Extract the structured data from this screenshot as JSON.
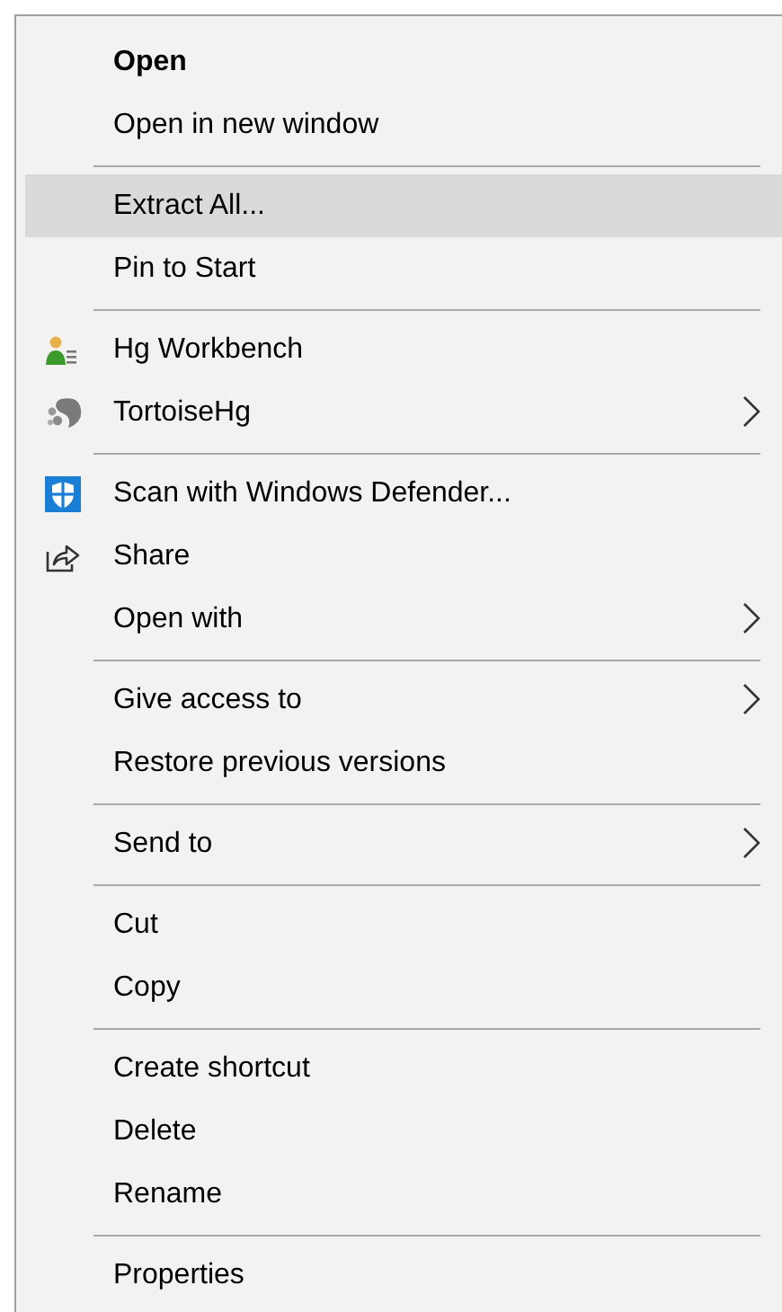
{
  "context_menu": {
    "groups": [
      [
        {
          "label": "Open",
          "kind": "plain",
          "default": true,
          "selected": false,
          "submenu": false
        },
        {
          "label": "Open in new window",
          "kind": "plain",
          "default": false,
          "selected": false,
          "submenu": false
        }
      ],
      [
        {
          "label": "Extract All...",
          "kind": "plain",
          "default": false,
          "selected": true,
          "submenu": false
        },
        {
          "label": "Pin to Start",
          "kind": "plain",
          "default": false,
          "selected": false,
          "submenu": false
        }
      ],
      [
        {
          "label": "Hg Workbench",
          "kind": "workbench",
          "default": false,
          "selected": false,
          "submenu": false
        },
        {
          "label": "TortoiseHg",
          "kind": "tortoise",
          "default": false,
          "selected": false,
          "submenu": true
        }
      ],
      [
        {
          "label": "Scan with Windows Defender...",
          "kind": "shield",
          "default": false,
          "selected": false,
          "submenu": false
        },
        {
          "label": "Share",
          "kind": "share",
          "default": false,
          "selected": false,
          "submenu": false
        },
        {
          "label": "Open with",
          "kind": "plain",
          "default": false,
          "selected": false,
          "submenu": true
        }
      ],
      [
        {
          "label": "Give access to",
          "kind": "plain",
          "default": false,
          "selected": false,
          "submenu": true
        },
        {
          "label": "Restore previous versions",
          "kind": "plain",
          "default": false,
          "selected": false,
          "submenu": false
        }
      ],
      [
        {
          "label": "Send to",
          "kind": "plain",
          "default": false,
          "selected": false,
          "submenu": true
        }
      ],
      [
        {
          "label": "Cut",
          "kind": "plain",
          "default": false,
          "selected": false,
          "submenu": false
        },
        {
          "label": "Copy",
          "kind": "plain",
          "default": false,
          "selected": false,
          "submenu": false
        }
      ],
      [
        {
          "label": "Create shortcut",
          "kind": "plain",
          "default": false,
          "selected": false,
          "submenu": false
        },
        {
          "label": "Delete",
          "kind": "plain",
          "default": false,
          "selected": false,
          "submenu": false
        },
        {
          "label": "Rename",
          "kind": "plain",
          "default": false,
          "selected": false,
          "submenu": false
        }
      ],
      [
        {
          "label": "Properties",
          "kind": "plain",
          "default": false,
          "selected": false,
          "submenu": false
        }
      ]
    ]
  }
}
